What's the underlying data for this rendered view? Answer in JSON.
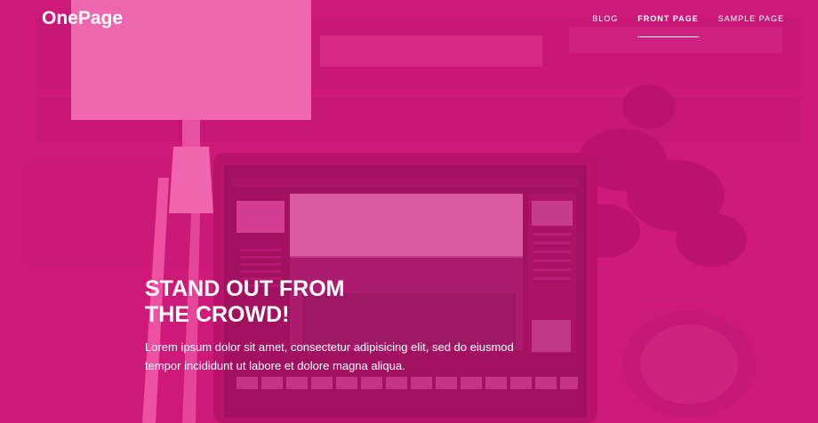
{
  "site": {
    "logo": "OnePage"
  },
  "nav": {
    "items": [
      {
        "label": "BLOG"
      },
      {
        "label": "FRONT PAGE"
      },
      {
        "label": "SAMPLE PAGE"
      }
    ]
  },
  "hero": {
    "headline_line1": "STAND OUT FROM",
    "headline_line2": "THE CROWD!",
    "subtext_line1": "Lorem ipsum dolor sit amet, consectetur adipisicing elit, sed do eiusmod",
    "subtext_line2": "tempor incididunt ut labore et dolore magna aliqua."
  },
  "colors": {
    "overlay": "#e8238c",
    "text": "#ffffff"
  }
}
